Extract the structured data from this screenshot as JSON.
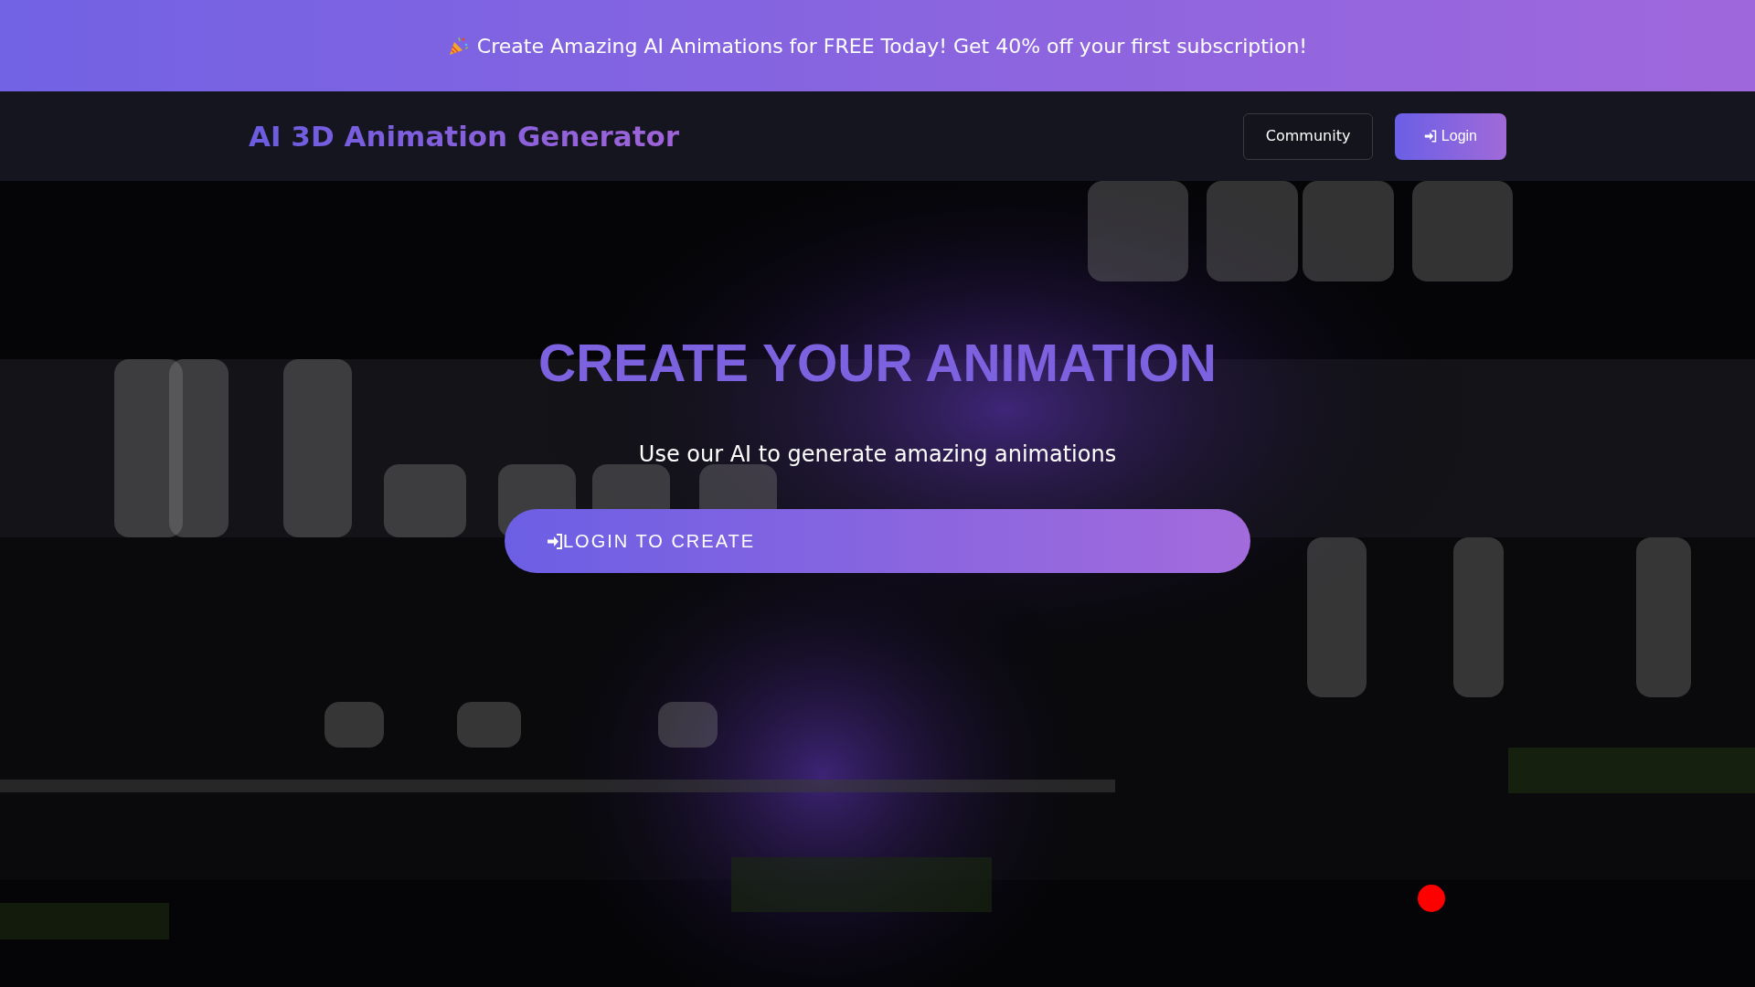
{
  "banner": {
    "text": "Create Amazing AI Animations for FREE Today! Get 40% off your first subscription!"
  },
  "navbar": {
    "brand": "AI 3D Animation Generator",
    "buttons": [
      {
        "label": "Community",
        "kind": "outline"
      },
      {
        "label": "Login",
        "kind": "primary"
      }
    ]
  },
  "hero": {
    "title": "CREATE YOUR ANIMATION",
    "subtitle": "Use our AI to generate amazing animations",
    "cta": {
      "label": "LOGIN TO CREATE"
    }
  }
}
